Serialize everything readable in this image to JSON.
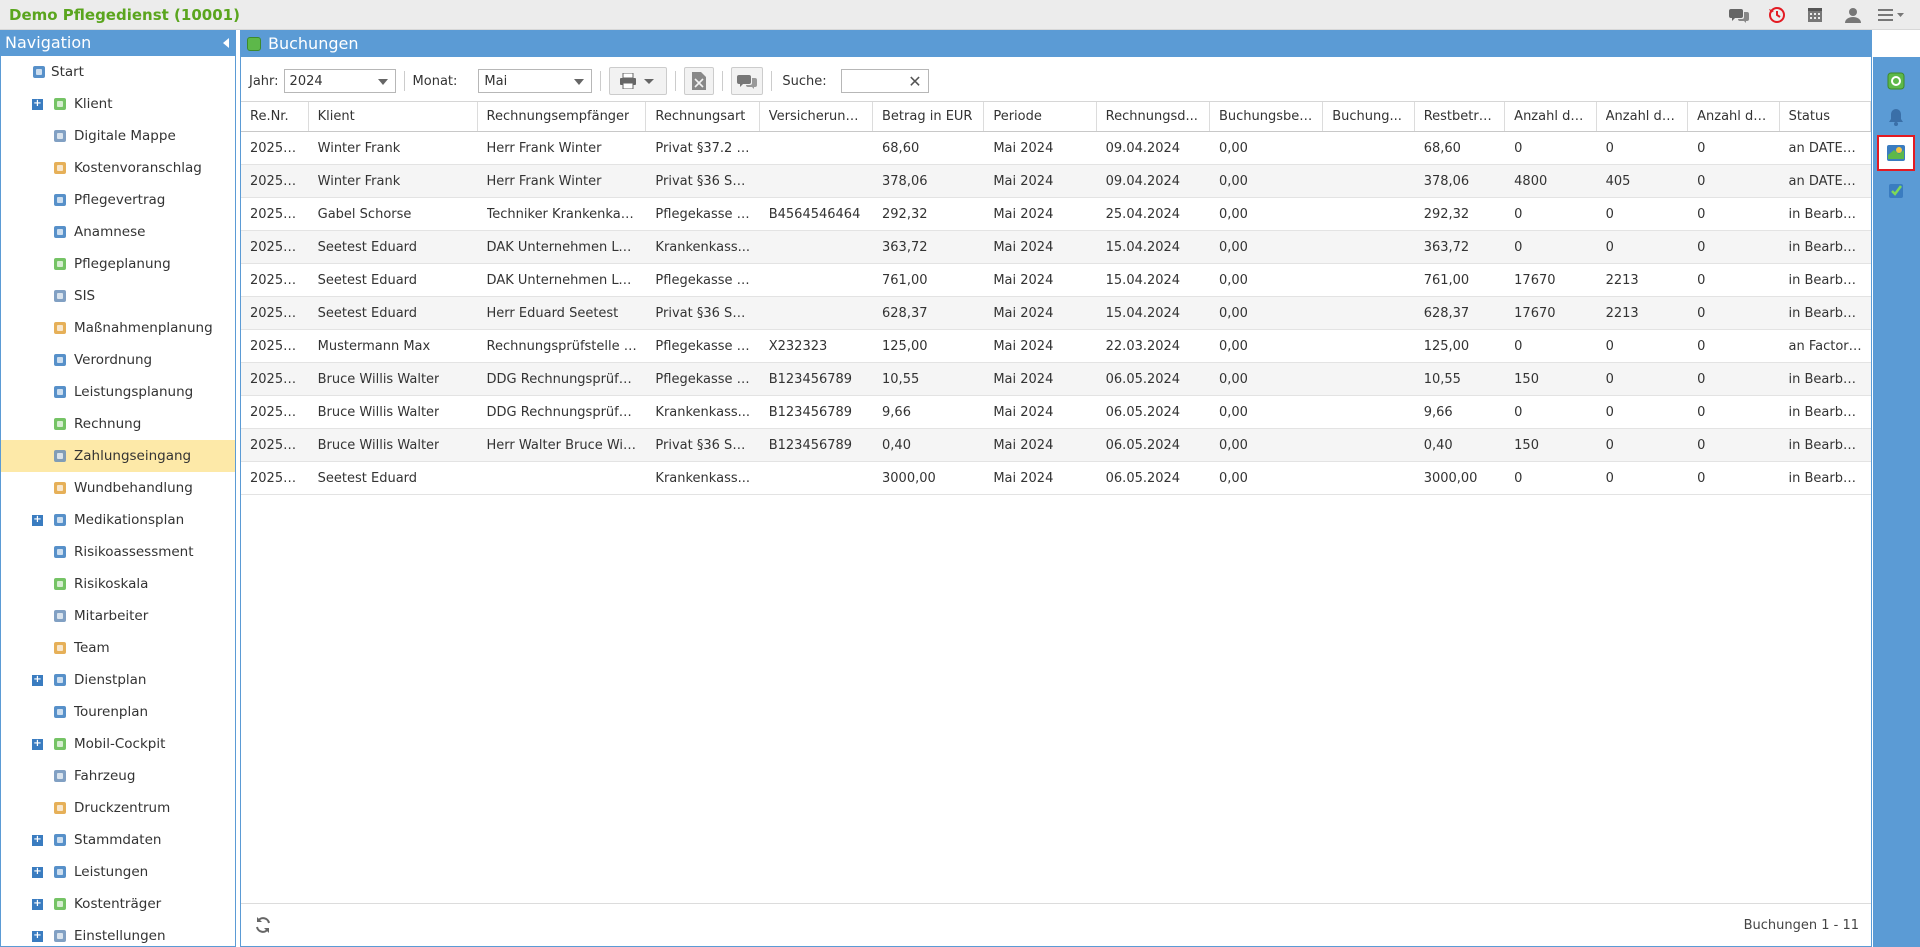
{
  "app": {
    "title": "Demo Pflegedienst (10001)"
  },
  "top_icons": [
    "chat-icon",
    "history-icon",
    "calendar-icon",
    "user-icon",
    "menu-icon"
  ],
  "navigation": {
    "title": "Navigation",
    "items": [
      {
        "label": "Start",
        "level": 0,
        "expandable": false,
        "icon": "home-icon",
        "active": false
      },
      {
        "label": "Klient",
        "level": 1,
        "expandable": true,
        "icon": "clients-icon",
        "active": false
      },
      {
        "label": "Digitale Mappe",
        "level": 1,
        "expandable": false,
        "icon": "folder-icon",
        "active": false
      },
      {
        "label": "Kostenvoranschlag",
        "level": 1,
        "expandable": false,
        "icon": "estimate-icon",
        "active": false
      },
      {
        "label": "Pflegevertrag",
        "level": 1,
        "expandable": false,
        "icon": "contract-icon",
        "active": false
      },
      {
        "label": "Anamnese",
        "level": 1,
        "expandable": false,
        "icon": "clipboard-icon",
        "active": false
      },
      {
        "label": "Pflegeplanung",
        "level": 1,
        "expandable": false,
        "icon": "care-plan-icon",
        "active": false
      },
      {
        "label": "SIS",
        "level": 1,
        "expandable": false,
        "icon": "document-icon",
        "active": false
      },
      {
        "label": "Maßnahmenplanung",
        "level": 1,
        "expandable": false,
        "icon": "clipboard-icon",
        "active": false
      },
      {
        "label": "Verordnung",
        "level": 1,
        "expandable": false,
        "icon": "stethoscope-icon",
        "active": false
      },
      {
        "label": "Leistungsplanung",
        "level": 1,
        "expandable": false,
        "icon": "clipboard-icon",
        "active": false
      },
      {
        "label": "Rechnung",
        "level": 1,
        "expandable": false,
        "icon": "invoice-icon",
        "active": false
      },
      {
        "label": "Zahlungseingang",
        "level": 1,
        "expandable": false,
        "icon": "payment-icon",
        "active": true
      },
      {
        "label": "Wundbehandlung",
        "level": 1,
        "expandable": false,
        "icon": "bandage-icon",
        "active": false
      },
      {
        "label": "Medikationsplan",
        "level": 1,
        "expandable": true,
        "icon": "medication-icon",
        "active": false
      },
      {
        "label": "Risikoassessment",
        "level": 1,
        "expandable": false,
        "icon": "magnifier-icon",
        "active": false
      },
      {
        "label": "Risikoskala",
        "level": 1,
        "expandable": false,
        "icon": "magnifier-icon",
        "active": false
      },
      {
        "label": "Mitarbeiter",
        "level": 1,
        "expandable": false,
        "icon": "nurse-icon",
        "active": false
      },
      {
        "label": "Team",
        "level": 1,
        "expandable": false,
        "icon": "team-icon",
        "active": false
      },
      {
        "label": "Dienstplan",
        "level": 1,
        "expandable": true,
        "icon": "schedule-icon",
        "active": false
      },
      {
        "label": "Tourenplan",
        "level": 1,
        "expandable": false,
        "icon": "route-icon",
        "active": false
      },
      {
        "label": "Mobil-Cockpit",
        "level": 1,
        "expandable": true,
        "icon": "cloud-icon",
        "active": false
      },
      {
        "label": "Fahrzeug",
        "level": 1,
        "expandable": false,
        "icon": "car-icon",
        "active": false
      },
      {
        "label": "Druckzentrum",
        "level": 1,
        "expandable": false,
        "icon": "printer-icon",
        "active": false
      },
      {
        "label": "Stammdaten",
        "level": 1,
        "expandable": true,
        "icon": "master-data-icon",
        "active": false
      },
      {
        "label": "Leistungen",
        "level": 1,
        "expandable": true,
        "icon": "heart-icon",
        "active": false
      },
      {
        "label": "Kostenträger",
        "level": 1,
        "expandable": true,
        "icon": "building-icon",
        "active": false
      },
      {
        "label": "Einstellungen",
        "level": 1,
        "expandable": true,
        "icon": "settings-icon",
        "active": false
      }
    ]
  },
  "panel": {
    "title": "Buchungen"
  },
  "toolbar": {
    "year_label": "Jahr:",
    "year_value": "2024",
    "month_label": "Monat:",
    "month_value": "Mai",
    "search_label": "Suche:",
    "search_value": "",
    "clear_symbol": "✕"
  },
  "table": {
    "columns": [
      "Re.Nr.",
      "Klient",
      "Rechnungsempfänger",
      "Rechnungsart",
      "Versicherung...",
      "Betrag in EUR",
      "Periode",
      "Rechnungsd...",
      "Buchungsbet...",
      "Buchung...",
      "Restbetra...",
      "Anzahl de...",
      "Anzahl de...",
      "Anzahl de...",
      "Status"
    ],
    "rows": [
      [
        "20250...",
        "Winter Frank",
        "Herr Frank Winter",
        "Privat §37.2 S...",
        "",
        "68,60",
        "Mai 2024",
        "09.04.2024",
        "0,00",
        "",
        "68,60",
        "0",
        "0",
        "0",
        "an DATEV..."
      ],
      [
        "20250...",
        "Winter Frank",
        "Herr Frank Winter",
        "Privat §36 SG...",
        "",
        "378,06",
        "Mai 2024",
        "09.04.2024",
        "0,00",
        "",
        "378,06",
        "4800",
        "405",
        "0",
        "an DATEV..."
      ],
      [
        "20250...",
        "Gabel Schorse",
        "Techniker Krankenkass...",
        "Pflegekasse §...",
        "B4564546464",
        "292,32",
        "Mai 2024",
        "25.04.2024",
        "0,00",
        "",
        "292,32",
        "0",
        "0",
        "0",
        "in Bearbe..."
      ],
      [
        "20250...",
        "Seetest Eduard",
        "DAK Unternehmen Leb...",
        "Krankenkass...",
        "",
        "363,72",
        "Mai 2024",
        "15.04.2024",
        "0,00",
        "",
        "363,72",
        "0",
        "0",
        "0",
        "in Bearbe..."
      ],
      [
        "20250...",
        "Seetest Eduard",
        "DAK Unternehmen Leb...",
        "Pflegekasse §...",
        "",
        "761,00",
        "Mai 2024",
        "15.04.2024",
        "0,00",
        "",
        "761,00",
        "17670",
        "2213",
        "0",
        "in Bearbe..."
      ],
      [
        "20250...",
        "Seetest Eduard",
        "Herr Eduard Seetest",
        "Privat §36 SG...",
        "",
        "628,37",
        "Mai 2024",
        "15.04.2024",
        "0,00",
        "",
        "628,37",
        "17670",
        "2213",
        "0",
        "in Bearbe..."
      ],
      [
        "20250...",
        "Mustermann Max",
        "Rechnungsprüfstelle C...",
        "Pflegekasse §...",
        "X232323",
        "125,00",
        "Mai 2024",
        "22.03.2024",
        "0,00",
        "",
        "125,00",
        "0",
        "0",
        "0",
        "an Factori..."
      ],
      [
        "20250...",
        "Bruce Willis Walter",
        "DDG Rechnungsprüfst...",
        "Pflegekasse §...",
        "B123456789",
        "10,55",
        "Mai 2024",
        "06.05.2024",
        "0,00",
        "",
        "10,55",
        "150",
        "0",
        "0",
        "in Bearbe..."
      ],
      [
        "20250...",
        "Bruce Willis Walter",
        "DDG Rechnungsprüfst...",
        "Krankenkass...",
        "B123456789",
        "9,66",
        "Mai 2024",
        "06.05.2024",
        "0,00",
        "",
        "9,66",
        "0",
        "0",
        "0",
        "in Bearbe..."
      ],
      [
        "20250...",
        "Bruce Willis Walter",
        "Herr Walter Bruce Willis",
        "Privat §36 SG...",
        "B123456789",
        "0,40",
        "Mai 2024",
        "06.05.2024",
        "0,00",
        "",
        "0,40",
        "150",
        "0",
        "0",
        "in Bearbe..."
      ],
      [
        "20250...",
        "Seetest Eduard",
        "",
        "Krankenkass...",
        "",
        "3000,00",
        "Mai 2024",
        "06.05.2024",
        "0,00",
        "",
        "3000,00",
        "0",
        "0",
        "0",
        "in Bearbe..."
      ]
    ]
  },
  "footer": {
    "pager": "Buchungen 1 - 11"
  },
  "right_sidebar": {
    "icons": [
      "payment-icon",
      "bell-icon",
      "booking-icon",
      "checklist-icon"
    ],
    "highlighted_index": 2,
    "highlight_color": "#e31b23"
  },
  "colors": {
    "accent": "#5b9bd5",
    "brand_green": "#5aa51e",
    "active_nav": "#fde9a8"
  }
}
